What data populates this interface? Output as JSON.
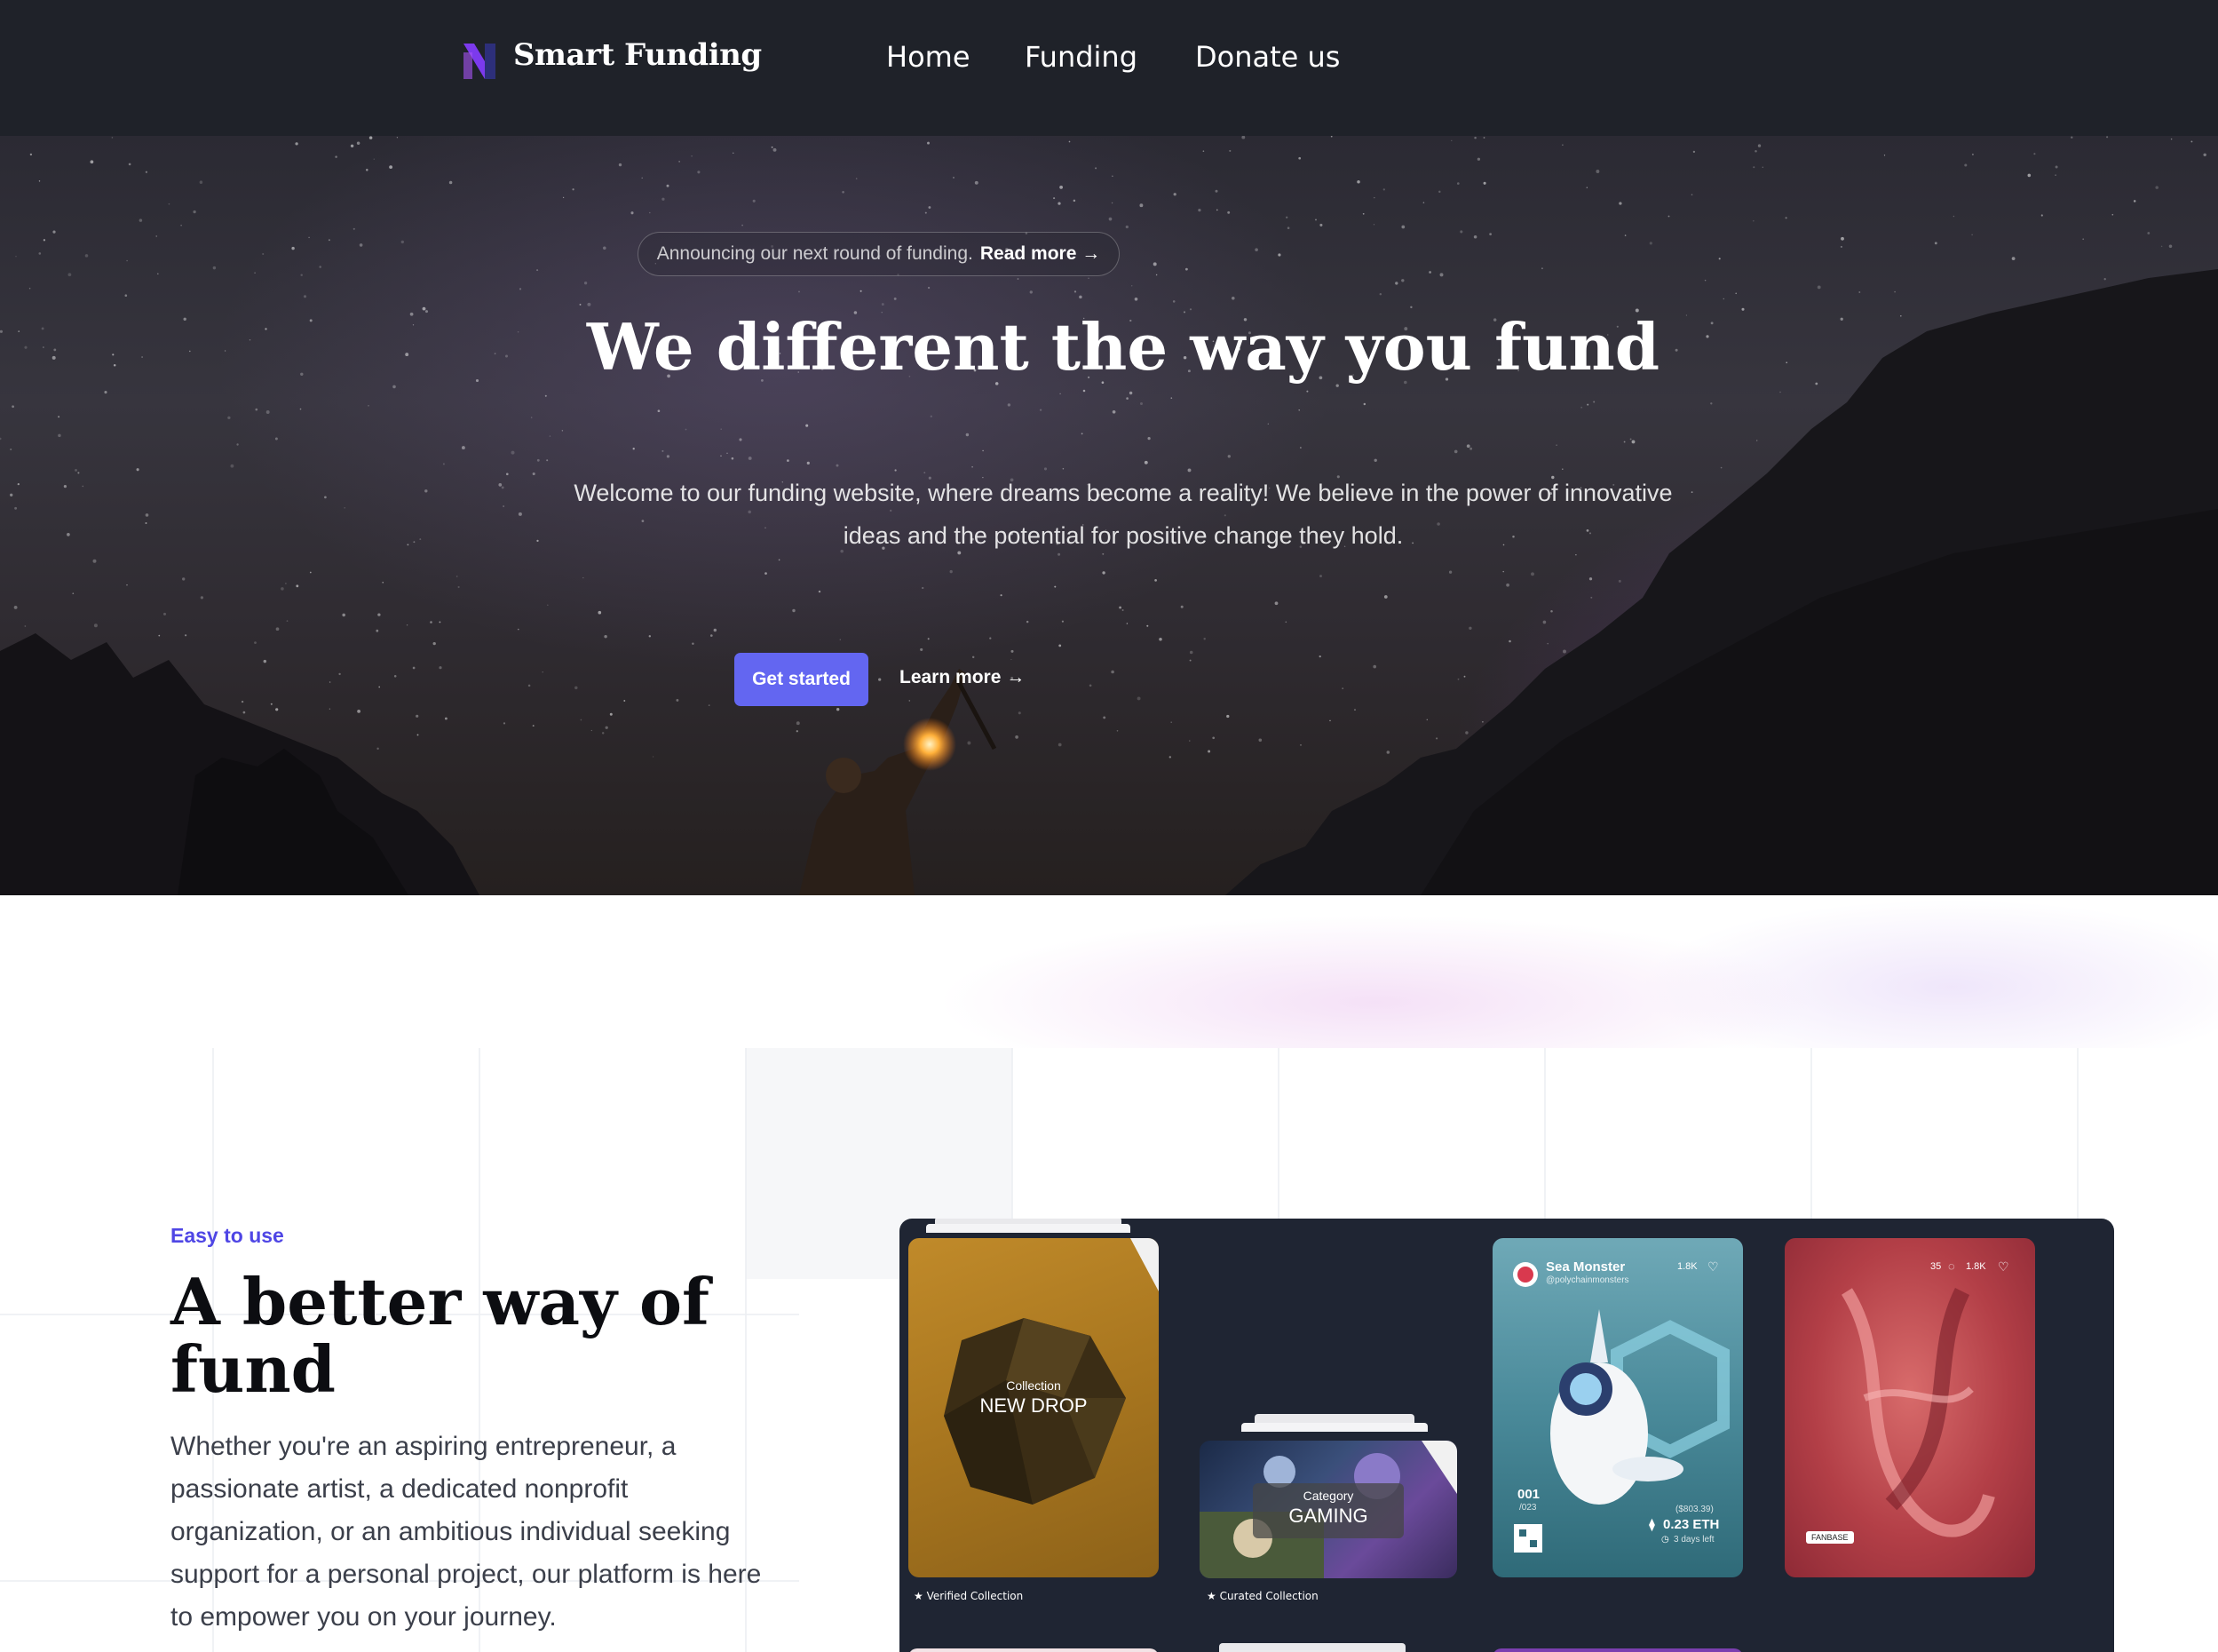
{
  "nav": {
    "brand": "Smart Funding",
    "links": [
      "Home",
      "Funding",
      "Donate us"
    ]
  },
  "hero": {
    "announcement": "Announcing our next round of funding.",
    "announcement_link": "Read more →",
    "title": "We different the way you fund",
    "subtitle": "Welcome to our funding website, where dreams become a reality! We believe in the power of innovative ideas and the potential for positive change they hold.",
    "primary_cta": "Get started",
    "secondary_cta": "Learn more →"
  },
  "feature": {
    "eyebrow": "Easy to use",
    "title": "A better way of fund",
    "body": "Whether you're an aspiring entrepreneur, a passionate artist, a dedicated nonprofit organization, or an ambitious individual seeking support for a personal project, our platform is here to empower you on your journey."
  },
  "showcase": {
    "card1": {
      "kicker": "Collection",
      "title": "NEW DROP",
      "caption": "★ Verified Collection"
    },
    "card2": {
      "kicker": "Category",
      "title": "GAMING",
      "caption": "★ Curated Collection"
    },
    "card3": {
      "name": "Sea Monster",
      "handle": "@polychainmonsters",
      "likes": "1.8K",
      "edition": "001",
      "edition_total": "/023",
      "usd": "($803.39)",
      "eth": "0.23 ETH",
      "time_left": "3 days left"
    },
    "card4": {
      "comments": "35",
      "likes": "1.8K",
      "badge": "FANBASE"
    }
  },
  "colors": {
    "nav_bg": "#1f2229",
    "accent": "#6366f1",
    "eyebrow": "#4f46e5",
    "showcase_bg": "#1f2533"
  }
}
